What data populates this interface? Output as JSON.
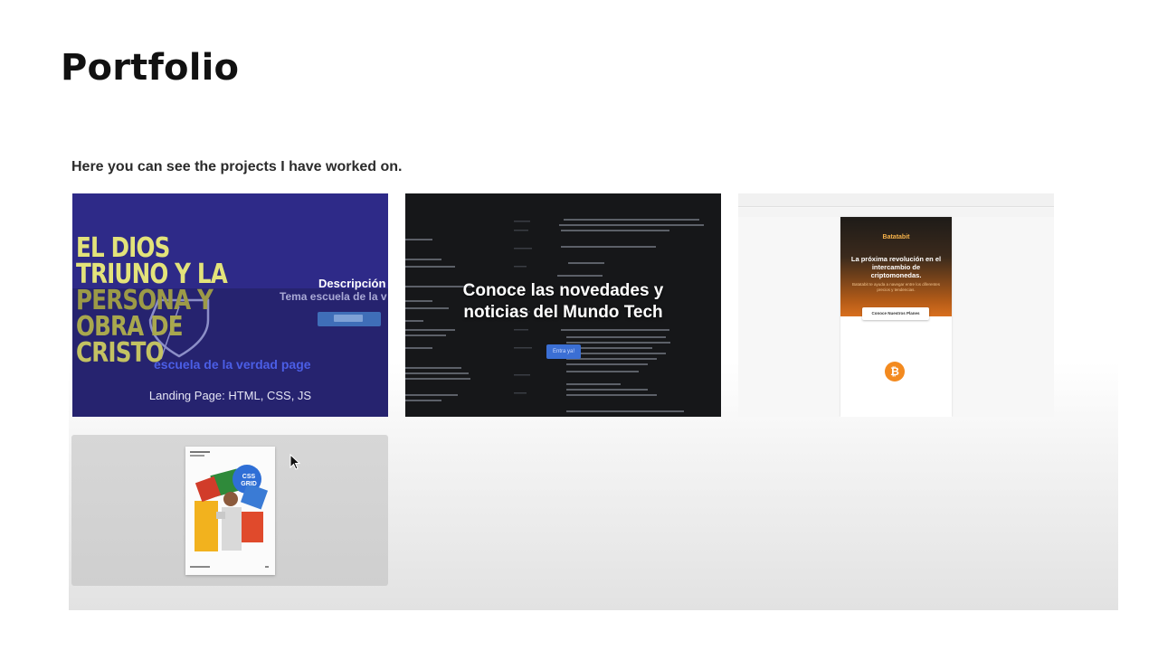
{
  "page": {
    "title": "Portfolio",
    "subtitle": "Here you can see the projects I have worked on."
  },
  "projects": [
    {
      "big_title_lines": [
        "EL DIOS",
        "TRIUNO Y LA",
        "PERSONA Y",
        "OBRA DE",
        "CRISTO"
      ],
      "section_label": "Descripción",
      "section_text": "Tema escuela de la v",
      "site_name": "escuela de la verdad page",
      "caption": "Landing Page: HTML, CSS, JS",
      "colors": {
        "background": "#2e2a88",
        "title": "#e3e37a",
        "accent": "#4b5ee6"
      }
    },
    {
      "headline_line1": "Conoce las novedades y",
      "headline_line2": "noticias del Mundo Tech",
      "button_label": "Entra ya!",
      "colors": {
        "background": "#161719",
        "button": "#3b6fd4"
      }
    },
    {
      "brand": "Batatabit",
      "tagline": "La próxima revolución en el intercambio de criptomonedas.",
      "subtext": "Batatabit te ayuda a navegar entre los diferentes precios y tendencias.",
      "cta_label": "Conoce Nuestros Planes",
      "coin_symbol": "₿",
      "colors": {
        "hero": "#d86f1e",
        "coin": "#f38a1f"
      }
    },
    {
      "poster_badge": "CSS GRID",
      "colors": {
        "background": "#d2d2d2"
      }
    }
  ]
}
